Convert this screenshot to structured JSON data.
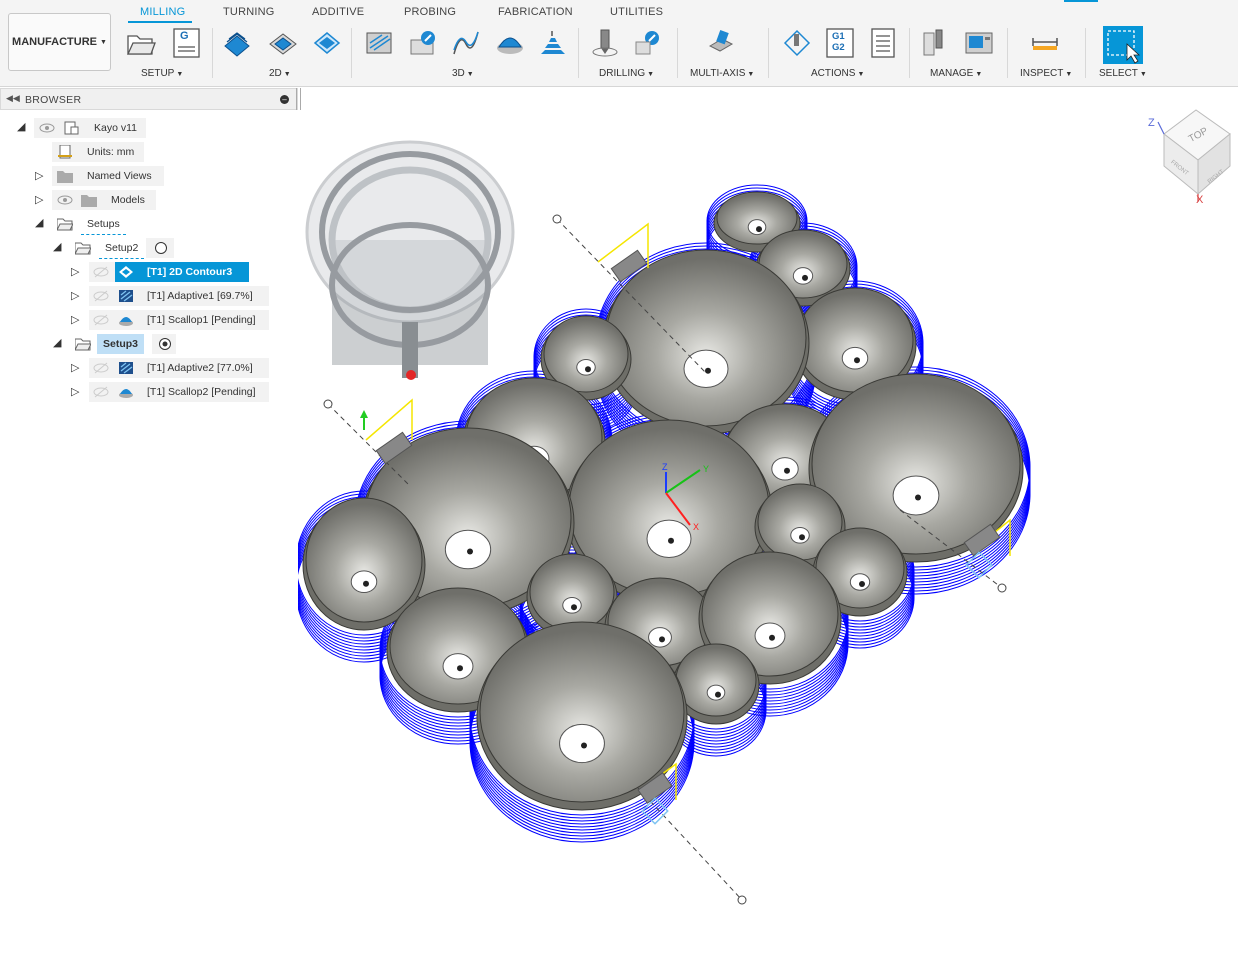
{
  "workspace": {
    "label": "MANUFACTURE"
  },
  "tabs": [
    "MILLING",
    "TURNING",
    "ADDITIVE",
    "PROBING",
    "FABRICATION",
    "UTILITIES"
  ],
  "active_tab": "MILLING",
  "groups": {
    "setup": "SETUP",
    "two_d": "2D",
    "three_d": "3D",
    "drilling": "DRILLING",
    "multi_axis": "MULTI-AXIS",
    "actions": "ACTIONS",
    "manage": "MANAGE",
    "inspect": "INSPECT",
    "select": "SELECT"
  },
  "toolbar_icons": {
    "g_code": "G",
    "g1g2_line1": "G1",
    "g1g2_line2": "G2"
  },
  "browser": {
    "title": "BROWSER",
    "root": "Kayo v11",
    "units": "Units: mm",
    "named_views": "Named Views",
    "models": "Models",
    "setups": "Setups",
    "setup2": {
      "label": "Setup2",
      "operations": [
        "[T1] 2D Contour3",
        "[T1] Adaptive1 [69.7%]",
        "[T1] Scallop1 [Pending]"
      ]
    },
    "setup3": {
      "label": "Setup3",
      "operations": [
        "[T1] Adaptive2 [77.0%]",
        "[T1] Scallop2 [Pending]"
      ]
    }
  },
  "viewcube": {
    "face": "TOP",
    "front": "FRONT",
    "right": "RIGHT",
    "axis_z": "Z",
    "axis_x": "X"
  },
  "axis_triad": {
    "x": "X",
    "y": "Y",
    "z": "Z"
  },
  "colors": {
    "accent": "#0696d7",
    "toolpath_blue": "#0000ff",
    "part_grey": "#8f8f8a",
    "lead_yellow": "#f5e600"
  }
}
